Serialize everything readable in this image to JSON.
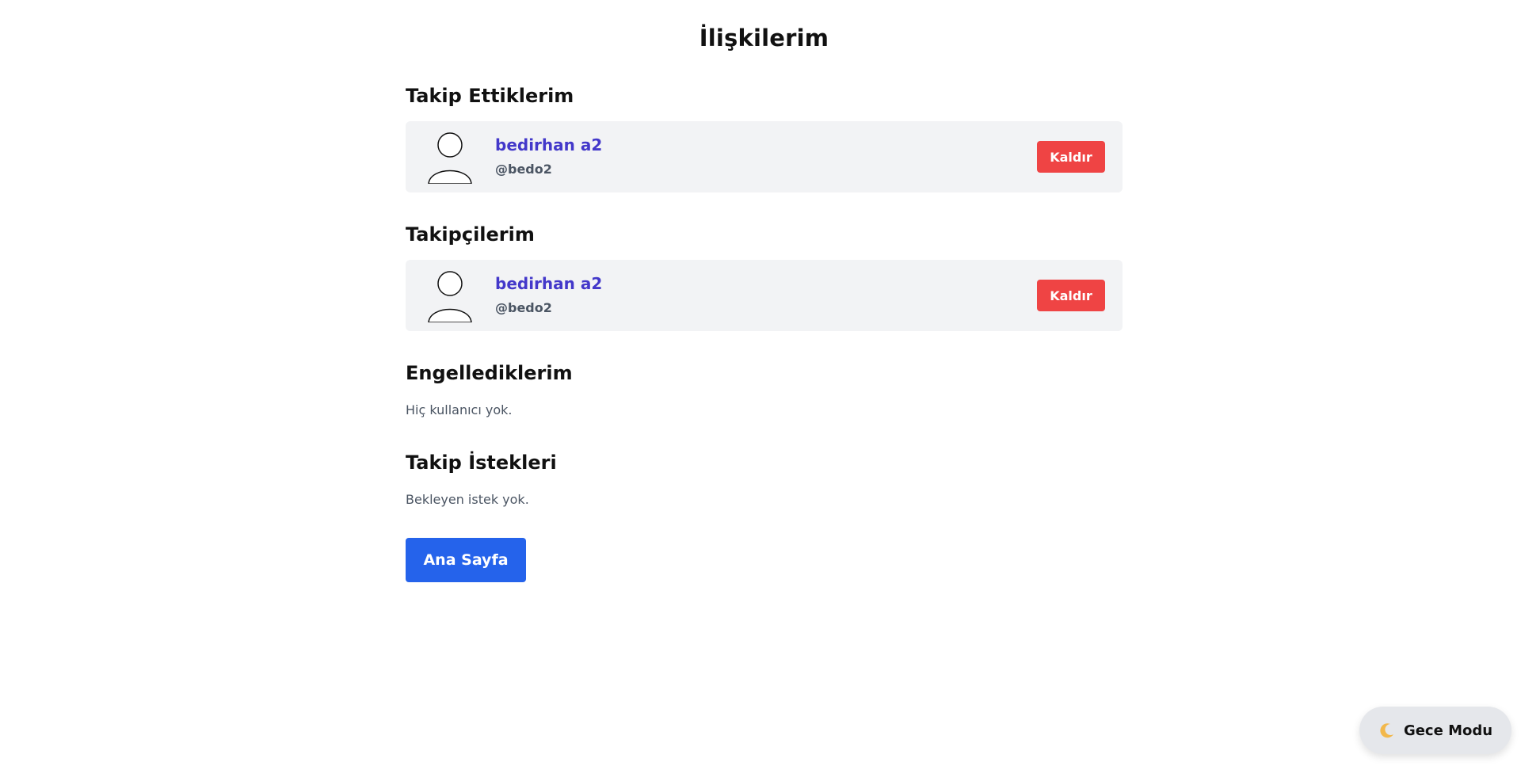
{
  "page": {
    "title": "İlişkilerim"
  },
  "following": {
    "title": "Takip Ettiklerim",
    "users": [
      {
        "name": "bedirhan a2",
        "handle": "@bedo2",
        "remove_label": "Kaldır",
        "avatar_icon": "default-user-avatar-icon"
      }
    ]
  },
  "followers": {
    "title": "Takipçilerim",
    "users": [
      {
        "name": "bedirhan a2",
        "handle": "@bedo2",
        "remove_label": "Kaldır",
        "avatar_icon": "default-user-avatar-icon"
      }
    ]
  },
  "blocked": {
    "title": "Engellediklerim",
    "empty_text": "Hiç kullanıcı yok."
  },
  "requests": {
    "title": "Takip İstekleri",
    "empty_text": "Bekleyen istek yok."
  },
  "actions": {
    "home_label": "Ana Sayfa"
  },
  "dark_mode": {
    "label": "Gece Modu",
    "icon": "moon-icon"
  },
  "colors": {
    "accent": "#2563eb",
    "username": "#4338ca",
    "danger": "#ef4444",
    "card_bg": "#f2f3f5"
  }
}
